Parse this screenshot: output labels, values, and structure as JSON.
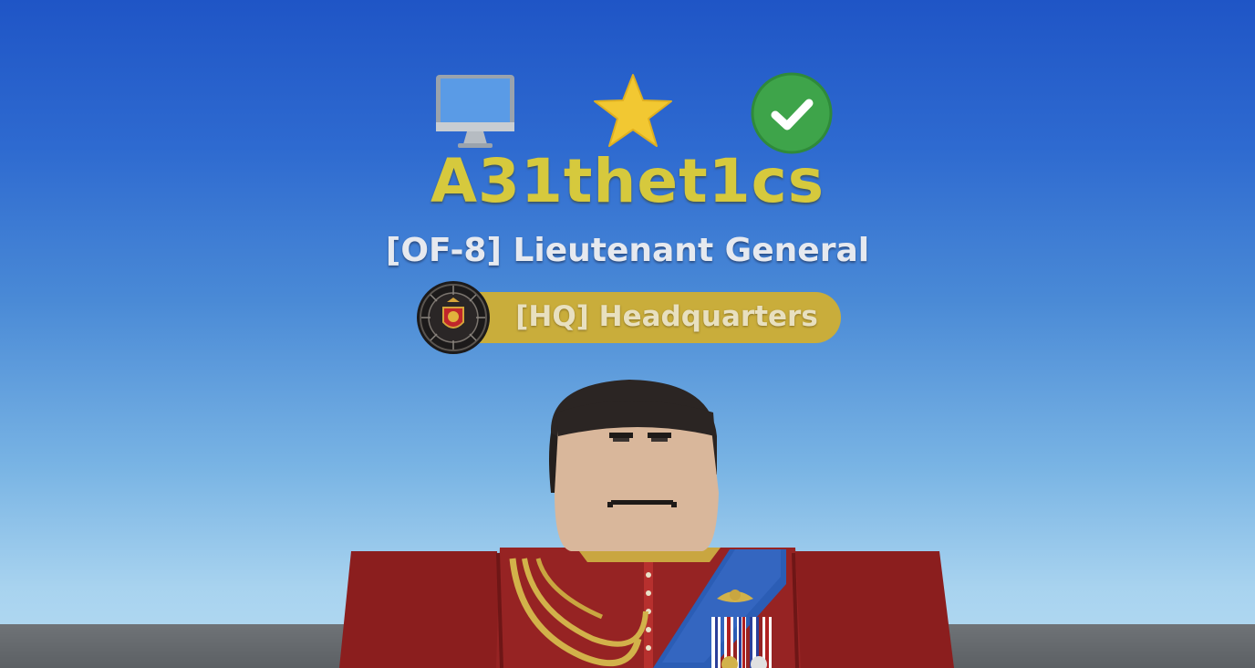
{
  "nameplate": {
    "icons": [
      "computer-icon",
      "star-icon",
      "verified-check-icon"
    ],
    "player_name": "A31thet1cs",
    "rank_title": "[OF-8] Lieutenant General",
    "division": {
      "label": "[HQ] Headquarters",
      "emblem": "division-emblem-icon"
    }
  },
  "colors": {
    "sky_top": "#1f55c6",
    "sky_bottom": "#b5dbf2",
    "name_gold": "#d6c93d",
    "rank_white": "#e6e9ef",
    "pill_gold": "#c9ad3b",
    "verified_green": "#3ea44a",
    "star_yellow": "#f2c832",
    "uniform_red": "#8e1f1f",
    "sash_blue": "#2a5cb4",
    "ground_gray": "#666a6e"
  },
  "avatar": {
    "name": "roblox-avatar",
    "outfit": "red-ceremonial-uniform"
  }
}
